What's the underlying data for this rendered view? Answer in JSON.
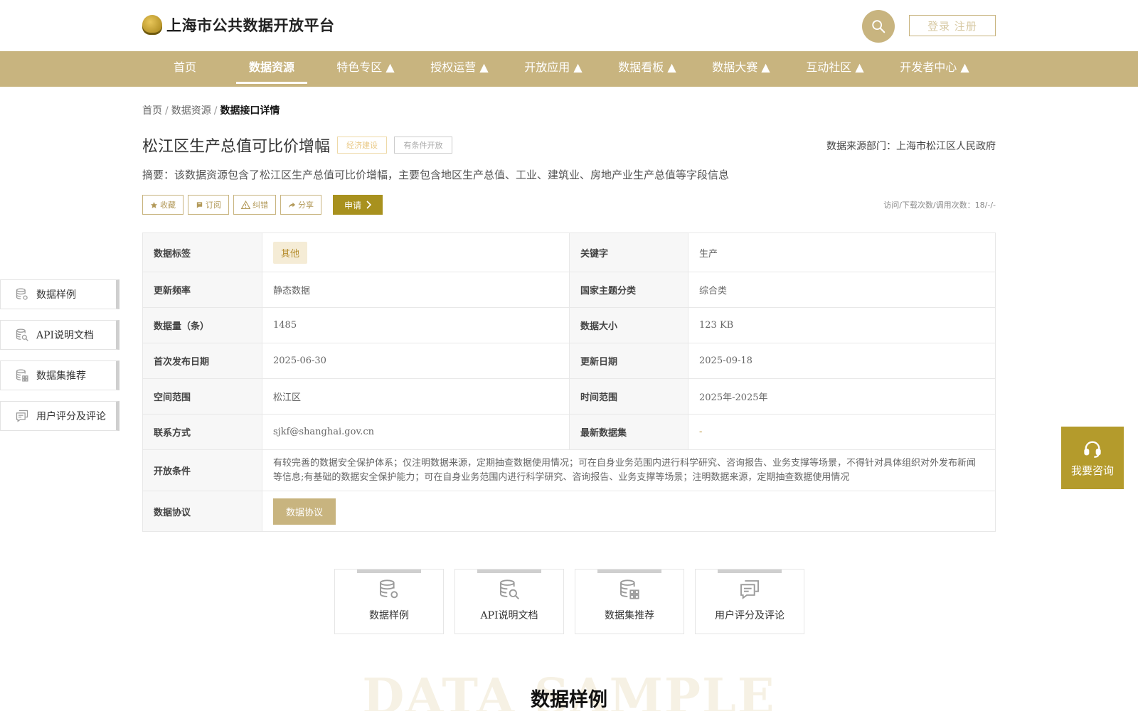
{
  "header": {
    "site_title": "上海市公共数据开放平台",
    "login_label": "登录 注册"
  },
  "nav": [
    {
      "label": "首页"
    },
    {
      "label": "数据资源"
    },
    {
      "label": "特色专区 ▲"
    },
    {
      "label": "授权运营 ▲"
    },
    {
      "label": "开放应用 ▲"
    },
    {
      "label": "数据看板 ▲"
    },
    {
      "label": "数据大赛 ▲"
    },
    {
      "label": "互动社区 ▲"
    },
    {
      "label": "开发者中心 ▲"
    }
  ],
  "breadcrumb": {
    "home": "首页",
    "sep": "/",
    "section": "数据资源",
    "current": "数据接口详情"
  },
  "dataset": {
    "title": "松江区生产总值可比价增幅",
    "tag_category": "经济建设",
    "tag_open": "有条件开放",
    "source": "数据来源部门：上海市松江区人民政府",
    "summary": "摘要：该数据资源包含了松江区生产总值可比价增幅，主要包含地区生产总值、工业、建筑业、房地产业生产总值等字段信息",
    "stats": "访问/下载次数/调用次数：18/-/-"
  },
  "actions": {
    "favorite": "收藏",
    "subscribe": "订阅",
    "report": "纠错",
    "share": "分享",
    "apply": "申请"
  },
  "table": {
    "tags_label": "数据标签",
    "tags_value": "其他",
    "keyword_label": "关键字",
    "keyword_value": "生产",
    "freq_label": "更新频率",
    "freq_value": "静态数据",
    "theme_label": "国家主题分类",
    "theme_value": "综合类",
    "count_label": "数据量（条）",
    "count_value": "1485",
    "size_label": "数据大小",
    "size_value": "123 KB",
    "first_pub_label": "首次发布日期",
    "first_pub_value": "2025-06-30",
    "update_label": "更新日期",
    "update_value": "2025-09-18",
    "space_label": "空间范围",
    "space_value": "松江区",
    "time_label": "时间范围",
    "time_value": "2025年-2025年",
    "contact_label": "联系方式",
    "contact_value": "sjkf@shanghai.gov.cn",
    "latest_label": "最新数据集",
    "latest_value": "-",
    "cond_label": "开放条件",
    "cond_value": "有较完善的数据安全保护体系；仅注明数据来源，定期抽查数据使用情况；可在自身业务范围内进行科学研究、咨询报告、业务支撑等场景，不得针对具体组织对外发布新闻等信息;有基础的数据安全保护能力；可在自身业务范围内进行科学研究、咨询报告、业务支撑等场景；注明数据来源，定期抽查数据使用情况",
    "protocol_label": "数据协议",
    "protocol_button": "数据协议"
  },
  "side_nav": [
    {
      "label": "数据样例",
      "icon": "database-gear-icon"
    },
    {
      "label": "API说明文档",
      "icon": "database-search-icon"
    },
    {
      "label": "数据集推荐",
      "icon": "database-grid-icon"
    },
    {
      "label": "用户评分及评论",
      "icon": "comment-icon"
    }
  ],
  "tabs": [
    {
      "label": "数据样例",
      "icon": "database-gear-icon"
    },
    {
      "label": "API说明文档",
      "icon": "database-search-icon"
    },
    {
      "label": "数据集推荐",
      "icon": "database-grid-icon"
    },
    {
      "label": "用户评分及评论",
      "icon": "comment-icon"
    }
  ],
  "consult": {
    "label": "我要咨询"
  },
  "section": {
    "bg_text": "DATA SAMPLE",
    "title": "数据样例"
  },
  "colors": {
    "brand": "#c8b47f",
    "accent_dark": "#a8911e",
    "consult": "#b49b2c"
  }
}
